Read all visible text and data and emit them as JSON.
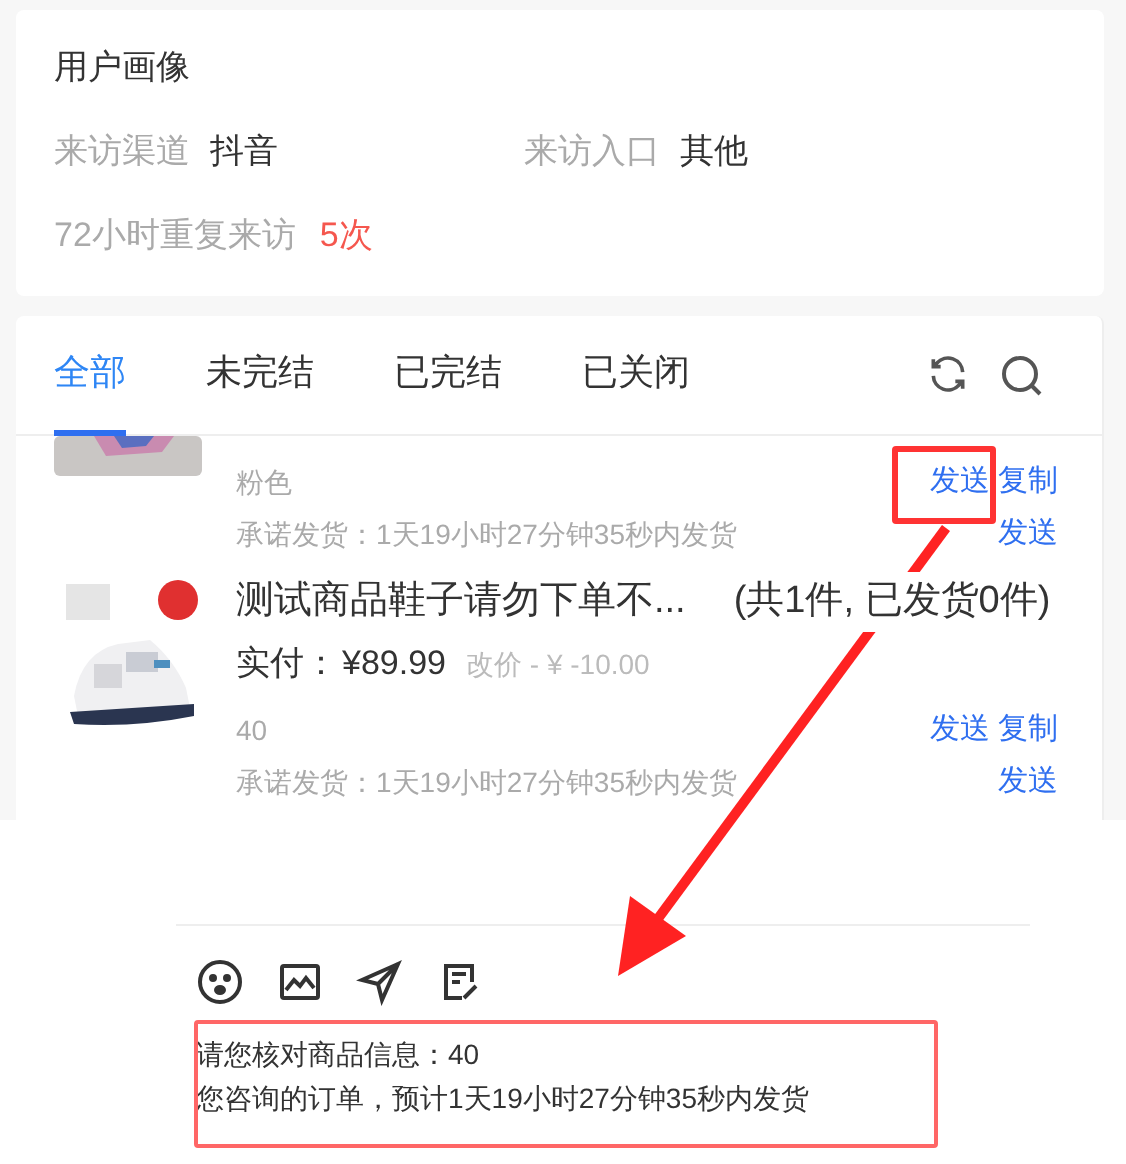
{
  "profile": {
    "title": "用户画像",
    "fields": [
      {
        "label": "来访渠道",
        "value": "抖音"
      },
      {
        "label": "来访入口",
        "value": "其他"
      }
    ],
    "revisit": {
      "label": "72小时重复来访",
      "value": "5次"
    }
  },
  "tabs": [
    {
      "label": "全部",
      "selected": true
    },
    {
      "label": "未完结",
      "selected": false
    },
    {
      "label": "已完结",
      "selected": false
    },
    {
      "label": "已关闭",
      "selected": false
    }
  ],
  "orders": [
    {
      "kind": "partial",
      "spec": "粉色",
      "promise": "承诺发货：1天19小时27分钟35秒内发货",
      "actions": [
        "发送",
        "复制",
        "发送"
      ]
    },
    {
      "kind": "full",
      "title": "测试商品鞋子请勿下单不...",
      "count": "(共1件, 已发货0件)",
      "paid_label": "实付：",
      "price": "¥89.99",
      "adjust": "改价 - ¥ -10.00",
      "spec": "40",
      "promise": "承诺发货：1天19小时27分钟35秒内发货",
      "actions": [
        "发送",
        "复制",
        "发送"
      ]
    }
  ],
  "composer": {
    "lines": [
      "请您核对商品信息：40",
      "您咨询的订单，预计1天19小时27分钟35秒内发货"
    ]
  }
}
